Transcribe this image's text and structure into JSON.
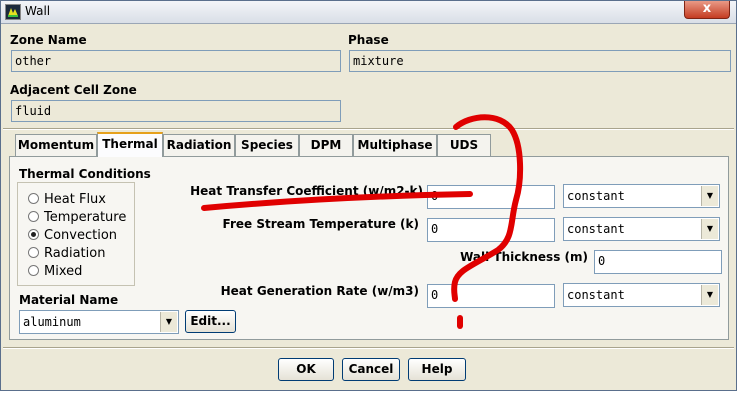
{
  "window": {
    "title": "Wall",
    "close_label": "x"
  },
  "zone": {
    "label": "Zone Name",
    "value": "other"
  },
  "phase": {
    "label": "Phase",
    "value": "mixture"
  },
  "adjacent": {
    "label": "Adjacent Cell Zone",
    "value": "fluid"
  },
  "tabs": [
    {
      "label": "Momentum"
    },
    {
      "label": "Thermal"
    },
    {
      "label": "Radiation"
    },
    {
      "label": "Species"
    },
    {
      "label": "DPM"
    },
    {
      "label": "Multiphase"
    },
    {
      "label": "UDS"
    }
  ],
  "active_tab": "Thermal",
  "thermal_conditions": {
    "label": "Thermal Conditions",
    "options": [
      "Heat Flux",
      "Temperature",
      "Convection",
      "Radiation",
      "Mixed"
    ],
    "selected": "Convection"
  },
  "material": {
    "label": "Material Name",
    "value": "aluminum",
    "edit_label": "Edit..."
  },
  "params": {
    "htc": {
      "label": "Heat Transfer Coefficient (w/m2-k)",
      "value": "0",
      "method": "constant"
    },
    "fst": {
      "label": "Free Stream Temperature (k)",
      "value": "0",
      "method": "constant"
    },
    "wall_thickness": {
      "label": "Wall Thickness (m)",
      "value": "0"
    },
    "hgr": {
      "label": "Heat Generation Rate (w/m3)",
      "value": "0",
      "method": "constant"
    }
  },
  "buttons": {
    "ok": "OK",
    "cancel": "Cancel",
    "help": "Help"
  },
  "colors": {
    "annotation": "#e00000",
    "tab_highlight": "#e6a11c",
    "dialog_bg": "#ece9d8"
  }
}
